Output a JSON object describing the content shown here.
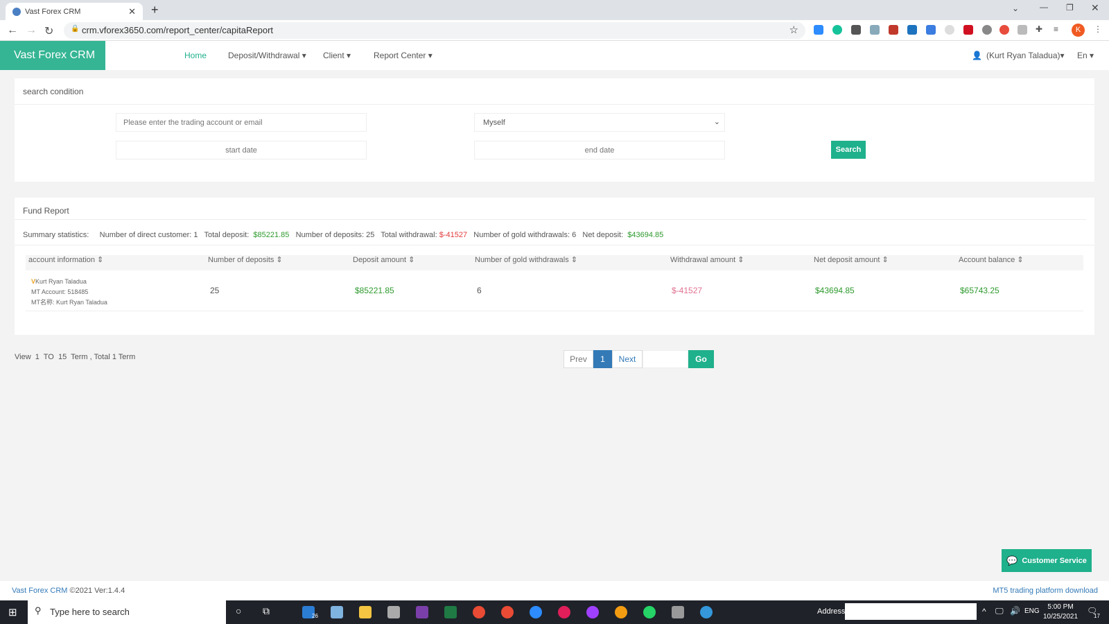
{
  "browser": {
    "tab_title": "Vast Forex CRM",
    "url": "crm.vforex3650.com/report_center/capitaReport",
    "profile_initial": "K"
  },
  "nav": {
    "logo": "Vast Forex CRM",
    "items": [
      {
        "label": "Home"
      },
      {
        "label": "Deposit/Withdrawal ▾"
      },
      {
        "label": "Client ▾"
      },
      {
        "label": "Report Center ▾"
      }
    ],
    "user": "(Kurt Ryan Taladua)▾",
    "lang": "En ▾"
  },
  "search": {
    "title": "search condition",
    "account_placeholder": "Please enter the trading account or email",
    "scope": "Myself",
    "start_placeholder": "start date",
    "end_placeholder": "end date",
    "button": "Search"
  },
  "report": {
    "title": "Fund Report",
    "summary": {
      "label": "Summary statistics:",
      "direct_customer_label": "Number of direct customer:",
      "direct_customer": "1",
      "total_deposit_label": "Total deposit:",
      "total_deposit": "$85221.85",
      "deposits_label": "Number of deposits:",
      "deposits": "25",
      "total_withdrawal_label": "Total withdrawal:",
      "total_withdrawal": "$-41527",
      "gold_withdrawals_label": "Number of gold withdrawals:",
      "gold_withdrawals": "6",
      "net_deposit_label": "Net deposit:",
      "net_deposit": "$43694.85"
    },
    "columns": [
      "account information ⇕",
      "Number of deposits ⇕",
      "Deposit amount ⇕",
      "Number of gold withdrawals ⇕",
      "Withdrawal amount ⇕",
      "Net deposit amount ⇕",
      "Account balance ⇕"
    ],
    "row": {
      "badge": "V",
      "name": "Kurt Ryan Taladua",
      "mt_account": "MT Account:  518485",
      "mt_name": "MT名称:  Kurt Ryan Taladua",
      "deposits": "25",
      "deposit_amount": "$85221.85",
      "gold_withdrawals": "6",
      "withdrawal_amount": "$-41527",
      "net_deposit": "$43694.85",
      "balance": "$65743.25"
    }
  },
  "pagination": {
    "info": "View  1  TO  15  Term , Total 1 Term",
    "prev": "Prev",
    "page": "1",
    "next": "Next",
    "go": "Go"
  },
  "customer_service": "Customer Service",
  "footer": {
    "left": "Vast Forex CRM",
    "copyright": " ©2021 Ver:1.4.4",
    "right": "MT5 trading platform download"
  },
  "taskbar": {
    "search_placeholder": "Type here to search",
    "address_label": "Address",
    "lang": "ENG",
    "time": "5:00 PM",
    "date": "10/25/2021",
    "mail_badge": "26",
    "notif_count": "17"
  }
}
